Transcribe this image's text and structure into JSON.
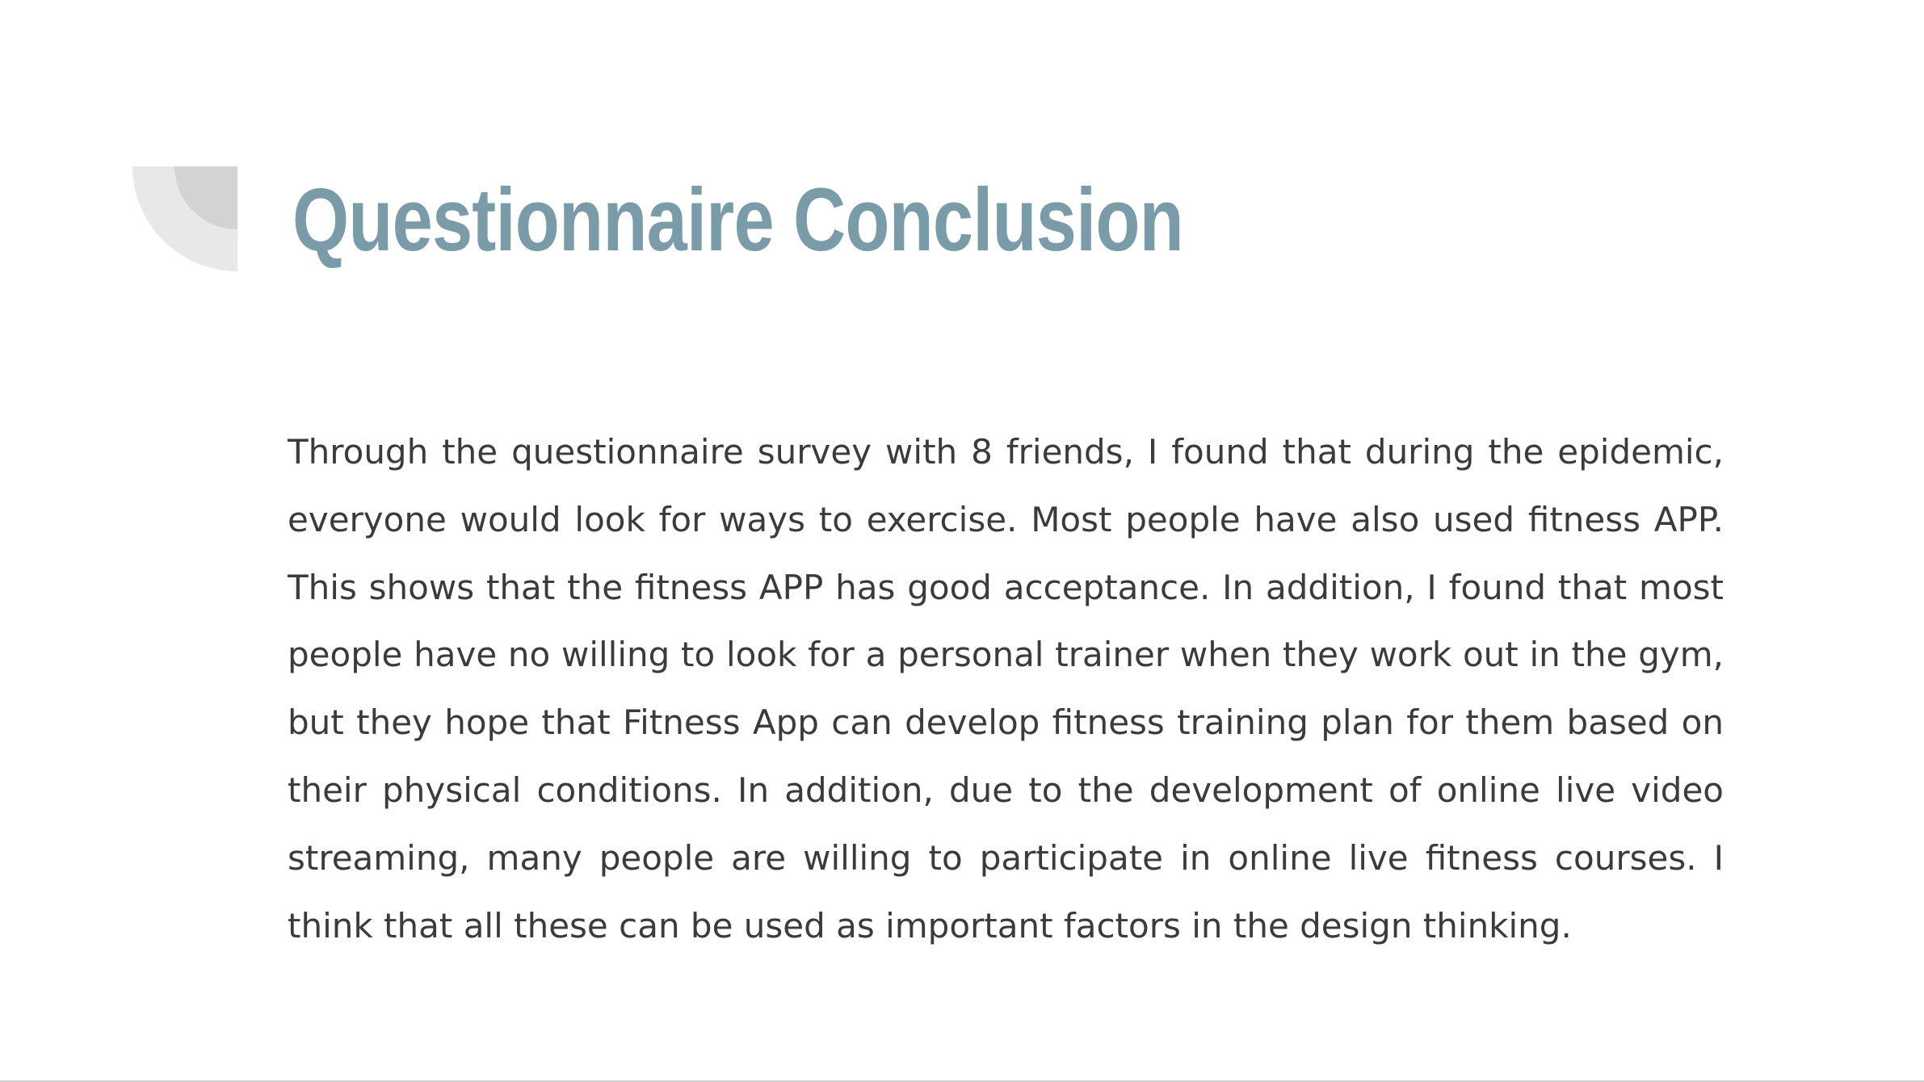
{
  "slide": {
    "title": "Questionnaire Conclusion",
    "body": "Through the questionnaire survey with 8 friends, I found that during the epidemic, everyone would look for ways to exercise. Most people have also used fitness APP. This shows that the fitness APP has good acceptance. In addition, I found that most people have no willing to look for a personal trainer when they work out in the gym, but they hope that Fitness App can develop fitness training plan for them based on their physical conditions. In addition, due to the development of online live video streaming, many people are willing to participate in online live fitness courses. I think that all these can be used as important factors in the design thinking."
  },
  "colors": {
    "title": "#7a9ca8",
    "body_text": "#3b3b3b",
    "deco_outer": "#e8e8e8",
    "deco_inner": "#d3d3d3",
    "background": "#ffffff"
  }
}
